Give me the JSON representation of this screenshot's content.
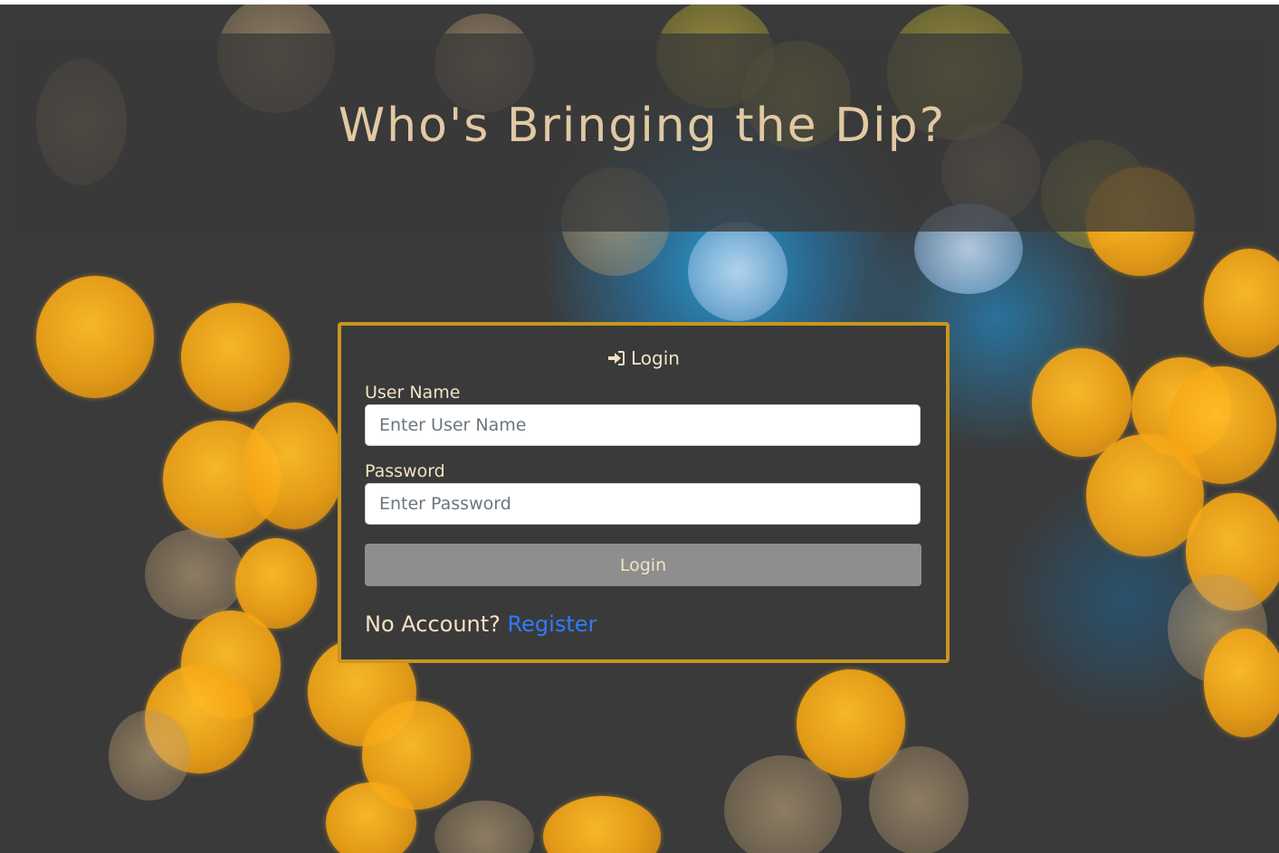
{
  "banner": {
    "title": "Who's Bringing the Dip?"
  },
  "login_card": {
    "title": "Login",
    "icon": "sign-in-icon",
    "username": {
      "label": "User Name",
      "placeholder": "Enter User Name",
      "value": ""
    },
    "password": {
      "label": "Password",
      "placeholder": "Enter Password",
      "value": ""
    },
    "submit_label": "Login",
    "no_account_text": "No Account?",
    "register_link": "Register"
  },
  "colors": {
    "banner_text": "#e1c9a3",
    "card_border": "#c8961e",
    "card_bg": "#3a3a3a",
    "label_text": "#f3e2c4",
    "button_bg": "#8e8e8e",
    "link": "#2f7bff"
  }
}
